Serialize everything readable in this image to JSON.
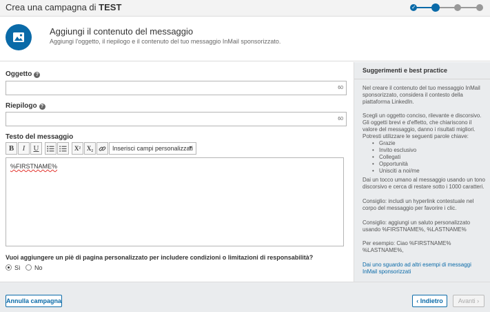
{
  "header": {
    "title_prefix": "Crea una campagna di",
    "campaign_name": "TEST"
  },
  "intro": {
    "title": "Aggiungi il contenuto del messaggio",
    "subtitle": "Aggiungi l'oggetto, il riepilogo e il contenuto del tuo messaggio InMail sponsorizzato."
  },
  "form": {
    "subject_label": "Oggetto",
    "subject_value": "",
    "subject_counter": "60",
    "summary_label": "Riepilogo",
    "summary_value": "",
    "summary_counter": "60",
    "body_label": "Testo del messaggio",
    "body_text": "%FIRSTNAME%",
    "toolbar": {
      "bold": "B",
      "italic": "I",
      "underline": "U",
      "superscript": "X²",
      "subscript": "X₂",
      "insert_fields": "Inserisci campi personalizzati"
    },
    "footer_question": "Vuoi aggiungere un piè di pagina personalizzato per includere condizioni o limitazioni di responsabilità?",
    "option_yes": "Sì",
    "option_no": "No",
    "selected_option": "Sì"
  },
  "sidebar": {
    "title": "Suggerimenti e best practice",
    "p1": "Nel creare il contenuto del tuo messaggio InMail sponsorizzato, considera il contesto della piattaforma LinkedIn.",
    "p2": "Scegli un oggetto conciso, rilevante e discorsivo. Gli oggetti brevi e d'effetto, che chiariscono il valore del messaggio, danno i risultati migliori. Potresti utilizzare le seguenti parole chiave:",
    "keywords": [
      "Grazie",
      "Invito esclusivo",
      "Collegati",
      "Opportunità",
      "Unisciti a noi/me"
    ],
    "p3": "Dai un tocco umano al messaggio usando un tono discorsivo e cerca di restare sotto i 1000 caratteri.",
    "p4": "Consiglio: includi un hyperlink contestuale nel corpo del messaggio per favorire i clic.",
    "p5": "Consiglio: aggiungi un saluto personalizzato usando %FIRSTNAME%, %LASTNAME%",
    "p6": "Per esempio: Ciao %FIRSTNAME% %LASTNAME%,",
    "link": "Dai uno sguardo ad altri esempi di messaggi InMail sponsorizzati"
  },
  "footer": {
    "cancel": "Annulla campagna",
    "back": "‹ Indietro",
    "next": "Avanti ›"
  },
  "colors": {
    "accent": "#0a6aa8",
    "sidebar_bg": "#eaecee"
  }
}
